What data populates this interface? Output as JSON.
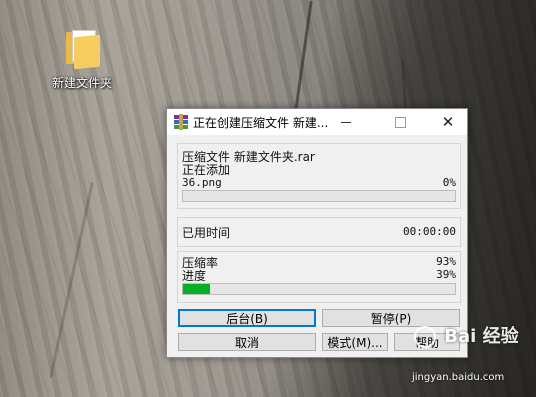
{
  "desktop": {
    "folder_label": "新建文件夹"
  },
  "window": {
    "title": "正在创建压缩文件 新建...",
    "archive_line": "压缩文件 新建文件夹.rar",
    "status_line": "正在添加",
    "current_file": "36.png",
    "file_percent": "0%",
    "file_progress": 0,
    "elapsed_label": "已用时间",
    "elapsed_value": "00:00:00",
    "ratio_label": "压缩率",
    "ratio_value": "93%",
    "progress_label": "进度",
    "progress_value": "39%",
    "progress_fraction": 0.1,
    "buttons": {
      "background": "后台(B)",
      "pause": "暂停(P)",
      "cancel": "取消",
      "mode": "模式(M)...",
      "help": "帮助"
    }
  },
  "watermark": {
    "brand": "Bai 经验",
    "url": "jingyan.baidu.com"
  },
  "colors": {
    "progress_fill": "#06b025",
    "default_button_border": "#0078d7"
  },
  "icons": [
    "folder-icon",
    "winrar-icon",
    "minimize-icon",
    "maximize-icon",
    "close-icon",
    "baidu-paw-icon"
  ]
}
